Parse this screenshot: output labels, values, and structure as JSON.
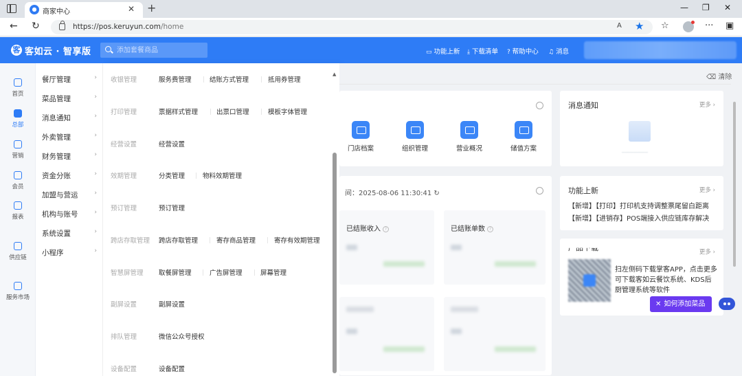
{
  "browser": {
    "tab_title": "商家中心",
    "url_host": "https://pos.keruyun.com",
    "url_path": "/home",
    "reader_label": "A",
    "profile_icon": "profile-avatar-icon"
  },
  "header": {
    "logo_mark": "客",
    "logo_text": "客如云 · 智享版",
    "search_placeholder": "添加套餐商品",
    "links": [
      {
        "label": "功能上新",
        "icon": "new-feature-icon"
      },
      {
        "label": "下载清单",
        "icon": "download-icon"
      },
      {
        "label": "帮助中心",
        "icon": "help-icon"
      },
      {
        "label": "消息",
        "icon": "bell-icon"
      }
    ],
    "accent": "#2e7cf6"
  },
  "rail": [
    {
      "label": "首页",
      "icon": "home-icon"
    },
    {
      "label": "总部",
      "icon": "headquarters-icon",
      "active": true
    },
    {
      "label": "营销",
      "icon": "marketing-icon"
    },
    {
      "label": "会员",
      "icon": "member-icon"
    },
    {
      "label": "报表",
      "icon": "report-icon"
    },
    {
      "label": "供应链",
      "icon": "supply-chain-icon"
    },
    {
      "label": "服务市场",
      "icon": "service-market-icon"
    }
  ],
  "menu": [
    "餐厅管理",
    "菜品管理",
    "消息通知",
    "外卖管理",
    "财务管理",
    "资金分账",
    "加盟与营运",
    "机构与账号",
    "系统设置",
    "小程序"
  ],
  "mega": [
    {
      "group": "收银管理",
      "links": [
        "服务费管理",
        "结账方式管理",
        "抵用券管理"
      ]
    },
    {
      "group": "打印管理",
      "links": [
        "票据样式管理",
        "出票口管理",
        "模板字体管理"
      ]
    },
    {
      "group": "经营设置",
      "links": [
        "经营设置"
      ]
    },
    {
      "group": "效期管理",
      "links": [
        "分类管理",
        "物料效期管理"
      ]
    },
    {
      "group": "预订管理",
      "links": [
        "预订管理"
      ]
    },
    {
      "group": "跨店存取管理",
      "links": [
        "跨店存取管理",
        "寄存商品管理",
        "寄存有效期管理"
      ]
    },
    {
      "group": "智慧屏管理",
      "links": [
        "取餐屏管理",
        "广告屏管理",
        "屏幕管理"
      ]
    },
    {
      "group": "副屏设置",
      "links": [
        "副屏设置"
      ]
    },
    {
      "group": "排队管理",
      "links": [
        "微信公众号授权"
      ]
    },
    {
      "group": "设备配置",
      "links": [
        "设备配置"
      ]
    }
  ],
  "main": {
    "clear_label": "清除",
    "shortcuts": [
      {
        "label": "门店档案",
        "icon": "store-file-icon"
      },
      {
        "label": "组织管理",
        "icon": "organization-icon"
      },
      {
        "label": "营业概况",
        "icon": "business-overview-icon"
      },
      {
        "label": "储值方案",
        "icon": "stored-value-icon"
      }
    ],
    "update_time": "间：2025-08-06 11:30:41",
    "stats": [
      {
        "title": "已结账收入"
      },
      {
        "title": "已结账单数"
      }
    ]
  },
  "side": {
    "messages": {
      "title": "消息通知",
      "more": "更多 ›"
    },
    "features": {
      "title": "功能上新",
      "more": "更多 ›",
      "lines": [
        "【新增】【打印】打印机支持调整票尾留白距离",
        "【新增】【进销存】POS端接入供应链库存解决"
      ]
    },
    "download": {
      "title": "产品下载",
      "more": "更多 ›",
      "text": "扫左侧码下载掌客APP，点击更多可下载客如云餐饮系统、KDS后厨管理系统等软件"
    }
  },
  "floating": {
    "label": "如何添加菜品",
    "close": "✕",
    "accent": "#6a3af0"
  }
}
